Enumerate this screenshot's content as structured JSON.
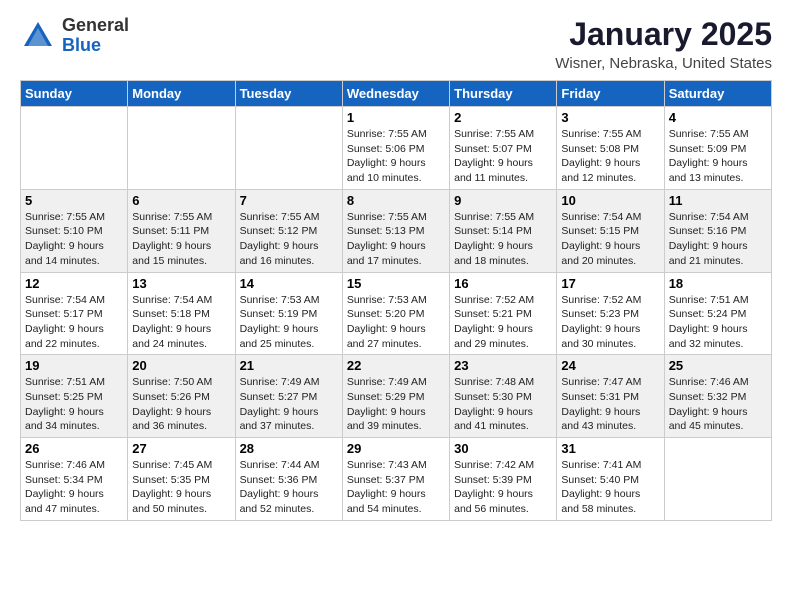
{
  "header": {
    "logo_general": "General",
    "logo_blue": "Blue",
    "month_title": "January 2025",
    "location": "Wisner, Nebraska, United States"
  },
  "weekdays": [
    "Sunday",
    "Monday",
    "Tuesday",
    "Wednesday",
    "Thursday",
    "Friday",
    "Saturday"
  ],
  "weeks": [
    {
      "shaded": false,
      "days": [
        {
          "num": "",
          "info": ""
        },
        {
          "num": "",
          "info": ""
        },
        {
          "num": "",
          "info": ""
        },
        {
          "num": "1",
          "info": "Sunrise: 7:55 AM\nSunset: 5:06 PM\nDaylight: 9 hours\nand 10 minutes."
        },
        {
          "num": "2",
          "info": "Sunrise: 7:55 AM\nSunset: 5:07 PM\nDaylight: 9 hours\nand 11 minutes."
        },
        {
          "num": "3",
          "info": "Sunrise: 7:55 AM\nSunset: 5:08 PM\nDaylight: 9 hours\nand 12 minutes."
        },
        {
          "num": "4",
          "info": "Sunrise: 7:55 AM\nSunset: 5:09 PM\nDaylight: 9 hours\nand 13 minutes."
        }
      ]
    },
    {
      "shaded": true,
      "days": [
        {
          "num": "5",
          "info": "Sunrise: 7:55 AM\nSunset: 5:10 PM\nDaylight: 9 hours\nand 14 minutes."
        },
        {
          "num": "6",
          "info": "Sunrise: 7:55 AM\nSunset: 5:11 PM\nDaylight: 9 hours\nand 15 minutes."
        },
        {
          "num": "7",
          "info": "Sunrise: 7:55 AM\nSunset: 5:12 PM\nDaylight: 9 hours\nand 16 minutes."
        },
        {
          "num": "8",
          "info": "Sunrise: 7:55 AM\nSunset: 5:13 PM\nDaylight: 9 hours\nand 17 minutes."
        },
        {
          "num": "9",
          "info": "Sunrise: 7:55 AM\nSunset: 5:14 PM\nDaylight: 9 hours\nand 18 minutes."
        },
        {
          "num": "10",
          "info": "Sunrise: 7:54 AM\nSunset: 5:15 PM\nDaylight: 9 hours\nand 20 minutes."
        },
        {
          "num": "11",
          "info": "Sunrise: 7:54 AM\nSunset: 5:16 PM\nDaylight: 9 hours\nand 21 minutes."
        }
      ]
    },
    {
      "shaded": false,
      "days": [
        {
          "num": "12",
          "info": "Sunrise: 7:54 AM\nSunset: 5:17 PM\nDaylight: 9 hours\nand 22 minutes."
        },
        {
          "num": "13",
          "info": "Sunrise: 7:54 AM\nSunset: 5:18 PM\nDaylight: 9 hours\nand 24 minutes."
        },
        {
          "num": "14",
          "info": "Sunrise: 7:53 AM\nSunset: 5:19 PM\nDaylight: 9 hours\nand 25 minutes."
        },
        {
          "num": "15",
          "info": "Sunrise: 7:53 AM\nSunset: 5:20 PM\nDaylight: 9 hours\nand 27 minutes."
        },
        {
          "num": "16",
          "info": "Sunrise: 7:52 AM\nSunset: 5:21 PM\nDaylight: 9 hours\nand 29 minutes."
        },
        {
          "num": "17",
          "info": "Sunrise: 7:52 AM\nSunset: 5:23 PM\nDaylight: 9 hours\nand 30 minutes."
        },
        {
          "num": "18",
          "info": "Sunrise: 7:51 AM\nSunset: 5:24 PM\nDaylight: 9 hours\nand 32 minutes."
        }
      ]
    },
    {
      "shaded": true,
      "days": [
        {
          "num": "19",
          "info": "Sunrise: 7:51 AM\nSunset: 5:25 PM\nDaylight: 9 hours\nand 34 minutes."
        },
        {
          "num": "20",
          "info": "Sunrise: 7:50 AM\nSunset: 5:26 PM\nDaylight: 9 hours\nand 36 minutes."
        },
        {
          "num": "21",
          "info": "Sunrise: 7:49 AM\nSunset: 5:27 PM\nDaylight: 9 hours\nand 37 minutes."
        },
        {
          "num": "22",
          "info": "Sunrise: 7:49 AM\nSunset: 5:29 PM\nDaylight: 9 hours\nand 39 minutes."
        },
        {
          "num": "23",
          "info": "Sunrise: 7:48 AM\nSunset: 5:30 PM\nDaylight: 9 hours\nand 41 minutes."
        },
        {
          "num": "24",
          "info": "Sunrise: 7:47 AM\nSunset: 5:31 PM\nDaylight: 9 hours\nand 43 minutes."
        },
        {
          "num": "25",
          "info": "Sunrise: 7:46 AM\nSunset: 5:32 PM\nDaylight: 9 hours\nand 45 minutes."
        }
      ]
    },
    {
      "shaded": false,
      "days": [
        {
          "num": "26",
          "info": "Sunrise: 7:46 AM\nSunset: 5:34 PM\nDaylight: 9 hours\nand 47 minutes."
        },
        {
          "num": "27",
          "info": "Sunrise: 7:45 AM\nSunset: 5:35 PM\nDaylight: 9 hours\nand 50 minutes."
        },
        {
          "num": "28",
          "info": "Sunrise: 7:44 AM\nSunset: 5:36 PM\nDaylight: 9 hours\nand 52 minutes."
        },
        {
          "num": "29",
          "info": "Sunrise: 7:43 AM\nSunset: 5:37 PM\nDaylight: 9 hours\nand 54 minutes."
        },
        {
          "num": "30",
          "info": "Sunrise: 7:42 AM\nSunset: 5:39 PM\nDaylight: 9 hours\nand 56 minutes."
        },
        {
          "num": "31",
          "info": "Sunrise: 7:41 AM\nSunset: 5:40 PM\nDaylight: 9 hours\nand 58 minutes."
        },
        {
          "num": "",
          "info": ""
        }
      ]
    }
  ]
}
